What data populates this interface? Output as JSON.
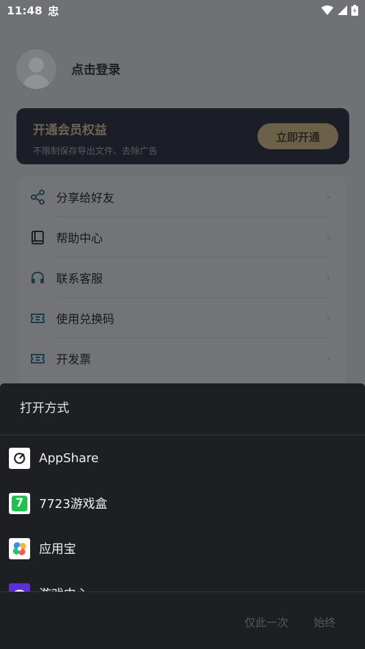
{
  "status_bar": {
    "time": "11:48",
    "notif": "忠"
  },
  "profile": {
    "login_text": "点击登录"
  },
  "vip": {
    "title": "开通会员权益",
    "subtitle": "不限制保存导出文件、去除广告",
    "button": "立即开通"
  },
  "menu": {
    "items": [
      {
        "label": "分享给好友",
        "icon": "share-icon"
      },
      {
        "label": "帮助中心",
        "icon": "book-icon"
      },
      {
        "label": "联系客服",
        "icon": "headphones-icon"
      },
      {
        "label": "使用兑换码",
        "icon": "ticket-icon"
      },
      {
        "label": "开发票",
        "icon": "ticket-icon"
      }
    ],
    "arrow": "›"
  },
  "sheet": {
    "title": "打开方式",
    "apps": [
      {
        "name": "AppShare",
        "icon": "appshare-icon"
      },
      {
        "name": "7723游戏盒",
        "icon": "7723-icon"
      },
      {
        "name": "应用宝",
        "icon": "yingyongbao-icon"
      },
      {
        "name": "游戏中心",
        "icon": "game-center-icon"
      }
    ],
    "app_7723_glyph": "7",
    "just_once": "仅此一次",
    "always": "始终"
  },
  "colors": {
    "sheet_bg": "#1d1f22",
    "vip_bg": "#1c1e27",
    "accent_7723": "#1fc24e"
  }
}
